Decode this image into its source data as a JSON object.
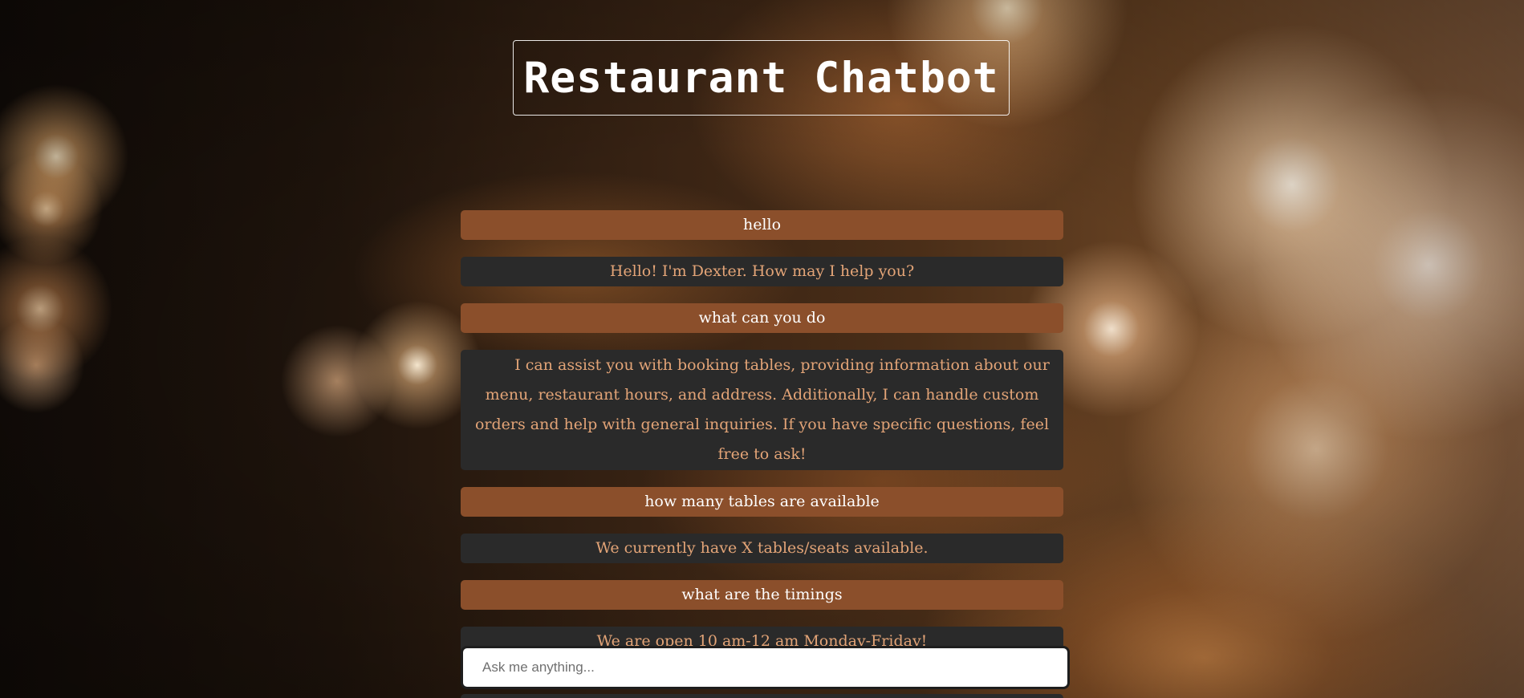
{
  "header": {
    "title": "Restaurant Chatbot"
  },
  "messages": [
    {
      "role": "user",
      "text": "hello"
    },
    {
      "role": "bot",
      "text": "Hello! I'm Dexter. How may I help you?"
    },
    {
      "role": "user",
      "text": "what can you do"
    },
    {
      "role": "bot",
      "text": "I can assist you with booking tables, providing information about our menu, restaurant hours, and address. Additionally, I can handle custom orders and help with general inquiries. If you have specific questions, feel free to ask!"
    },
    {
      "role": "user",
      "text": "how many tables are available"
    },
    {
      "role": "bot",
      "text": "We currently have X tables/seats available."
    },
    {
      "role": "user",
      "text": "what are the timings"
    },
    {
      "role": "bot",
      "text": "We are open 10 am-12 am Monday-Friday!"
    }
  ],
  "composer": {
    "placeholder": "Ask me anything...",
    "value": ""
  },
  "colors": {
    "user_bubble": "#8b4f2b",
    "bot_bubble": "#2a2a2a",
    "bot_text": "#e3a477",
    "user_text": "#ffffff"
  }
}
